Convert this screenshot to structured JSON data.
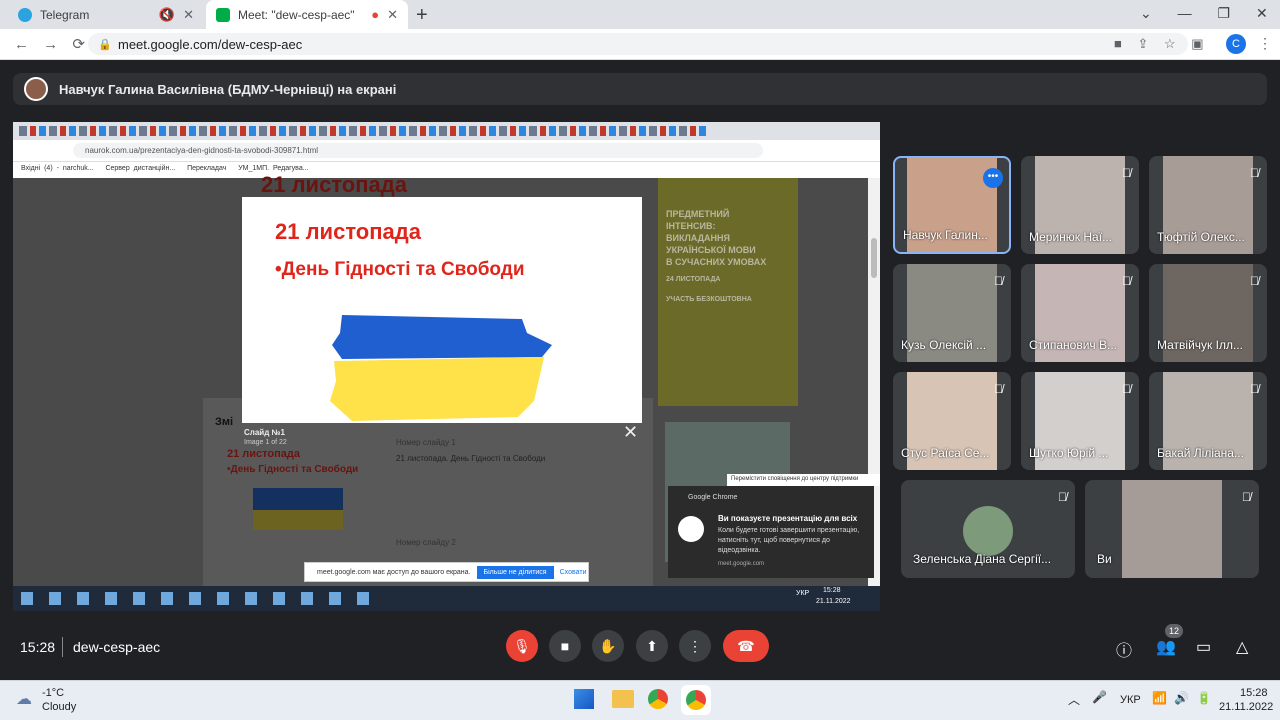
{
  "tabs": [
    {
      "label": "Telegram",
      "active": false
    },
    {
      "label": "Meet: \"dew-cesp-aec\"",
      "active": true
    }
  ],
  "address": "meet.google.com/dew-cesp-aec",
  "profile_letter": "C",
  "presenter_bar": "Навчук Галина Василівна (БДМУ-Чернівці) на екрані",
  "shared": {
    "tab_title": "",
    "url": "naurok.com.ua/prezentaciya-den-gidnosti-ta-svobodi-309871.html",
    "bookmarks": [
      "Вхідні (4) - narchuk...",
      "Сервер дистанційн...",
      "Перекладач",
      "УМ_1МП. Редагува..."
    ],
    "page_heading": "21 листопада",
    "slide_title": "21 листопада",
    "slide_subtitle": "•День Гідності та Свободи",
    "slide_caption": "Слайд №1",
    "slide_count": "Image 1 of 22",
    "list_item_title": "Номер слайду 1",
    "list_item_text": "21 листопада. День Гідності та Свободи",
    "list_item2_title": "Номер слайду 2",
    "thumb_title": "21 листопада",
    "thumb_sub": "•День Гідності та Свободи",
    "section_label": "Змі",
    "ad_line1": "ПРЕДМЕТНИЙ",
    "ad_line2": "ІНТЕНСИВ:",
    "ad_line3": "ВИКЛАДАННЯ",
    "ad_line4": "УКРАЇНСЬКОЇ МОВИ",
    "ad_line5": "В СУЧАСНИХ УМОВАХ",
    "ad_date": "24 ЛИСТОПАДА",
    "ad_cta": "УЧАСТЬ БЕЗКОШТОВНА",
    "sharing_notice": "meet.google.com має доступ до вашого екрана.",
    "stop_share": "Більше не ділитися",
    "hide": "Сховати",
    "tooltip": "Перемістити сповіщення до центру підтримки",
    "notif_app": "Google Chrome",
    "notif_title": "Ви показуєте презентацію для всіх",
    "notif_body": "Коли будете готові завершити презентацію, натисніть тут, щоб повернутися до відеодзвінка.",
    "notif_src": "meet.google.com",
    "inner_time": "15:28",
    "inner_date": "21.11.2022",
    "inner_lang": "УКР"
  },
  "participants": [
    {
      "name": "Навчук Галин...",
      "muted": false
    },
    {
      "name": "Меринюк Наї...",
      "muted": true
    },
    {
      "name": "Тюфтій Олекс...",
      "muted": true
    },
    {
      "name": "Кузь Олексій ...",
      "muted": true
    },
    {
      "name": "Стипанович В...",
      "muted": true
    },
    {
      "name": "Матвійчук Ілл...",
      "muted": true
    },
    {
      "name": "Стус Раїса Се...",
      "muted": true
    },
    {
      "name": "Шутко Юрій ...",
      "muted": true
    },
    {
      "name": "Бакай Ліліана...",
      "muted": true
    },
    {
      "name": "Зеленська Діана Сергії...",
      "muted": true
    },
    {
      "name": "Ви",
      "muted": true
    }
  ],
  "meeting_time": "15:28",
  "meeting_code": "dew-cesp-aec",
  "people_count": "12",
  "weather": {
    "temp": "-1°C",
    "desc": "Cloudy"
  },
  "tray": {
    "lang": "УКР",
    "time": "15:28",
    "date": "21.11.2022"
  },
  "colors": {
    "end_call": "#ea4335",
    "ukraine_blue": "#1f5fd0",
    "ukraine_yellow": "#ffe14a",
    "slide_red": "#e0251b"
  }
}
